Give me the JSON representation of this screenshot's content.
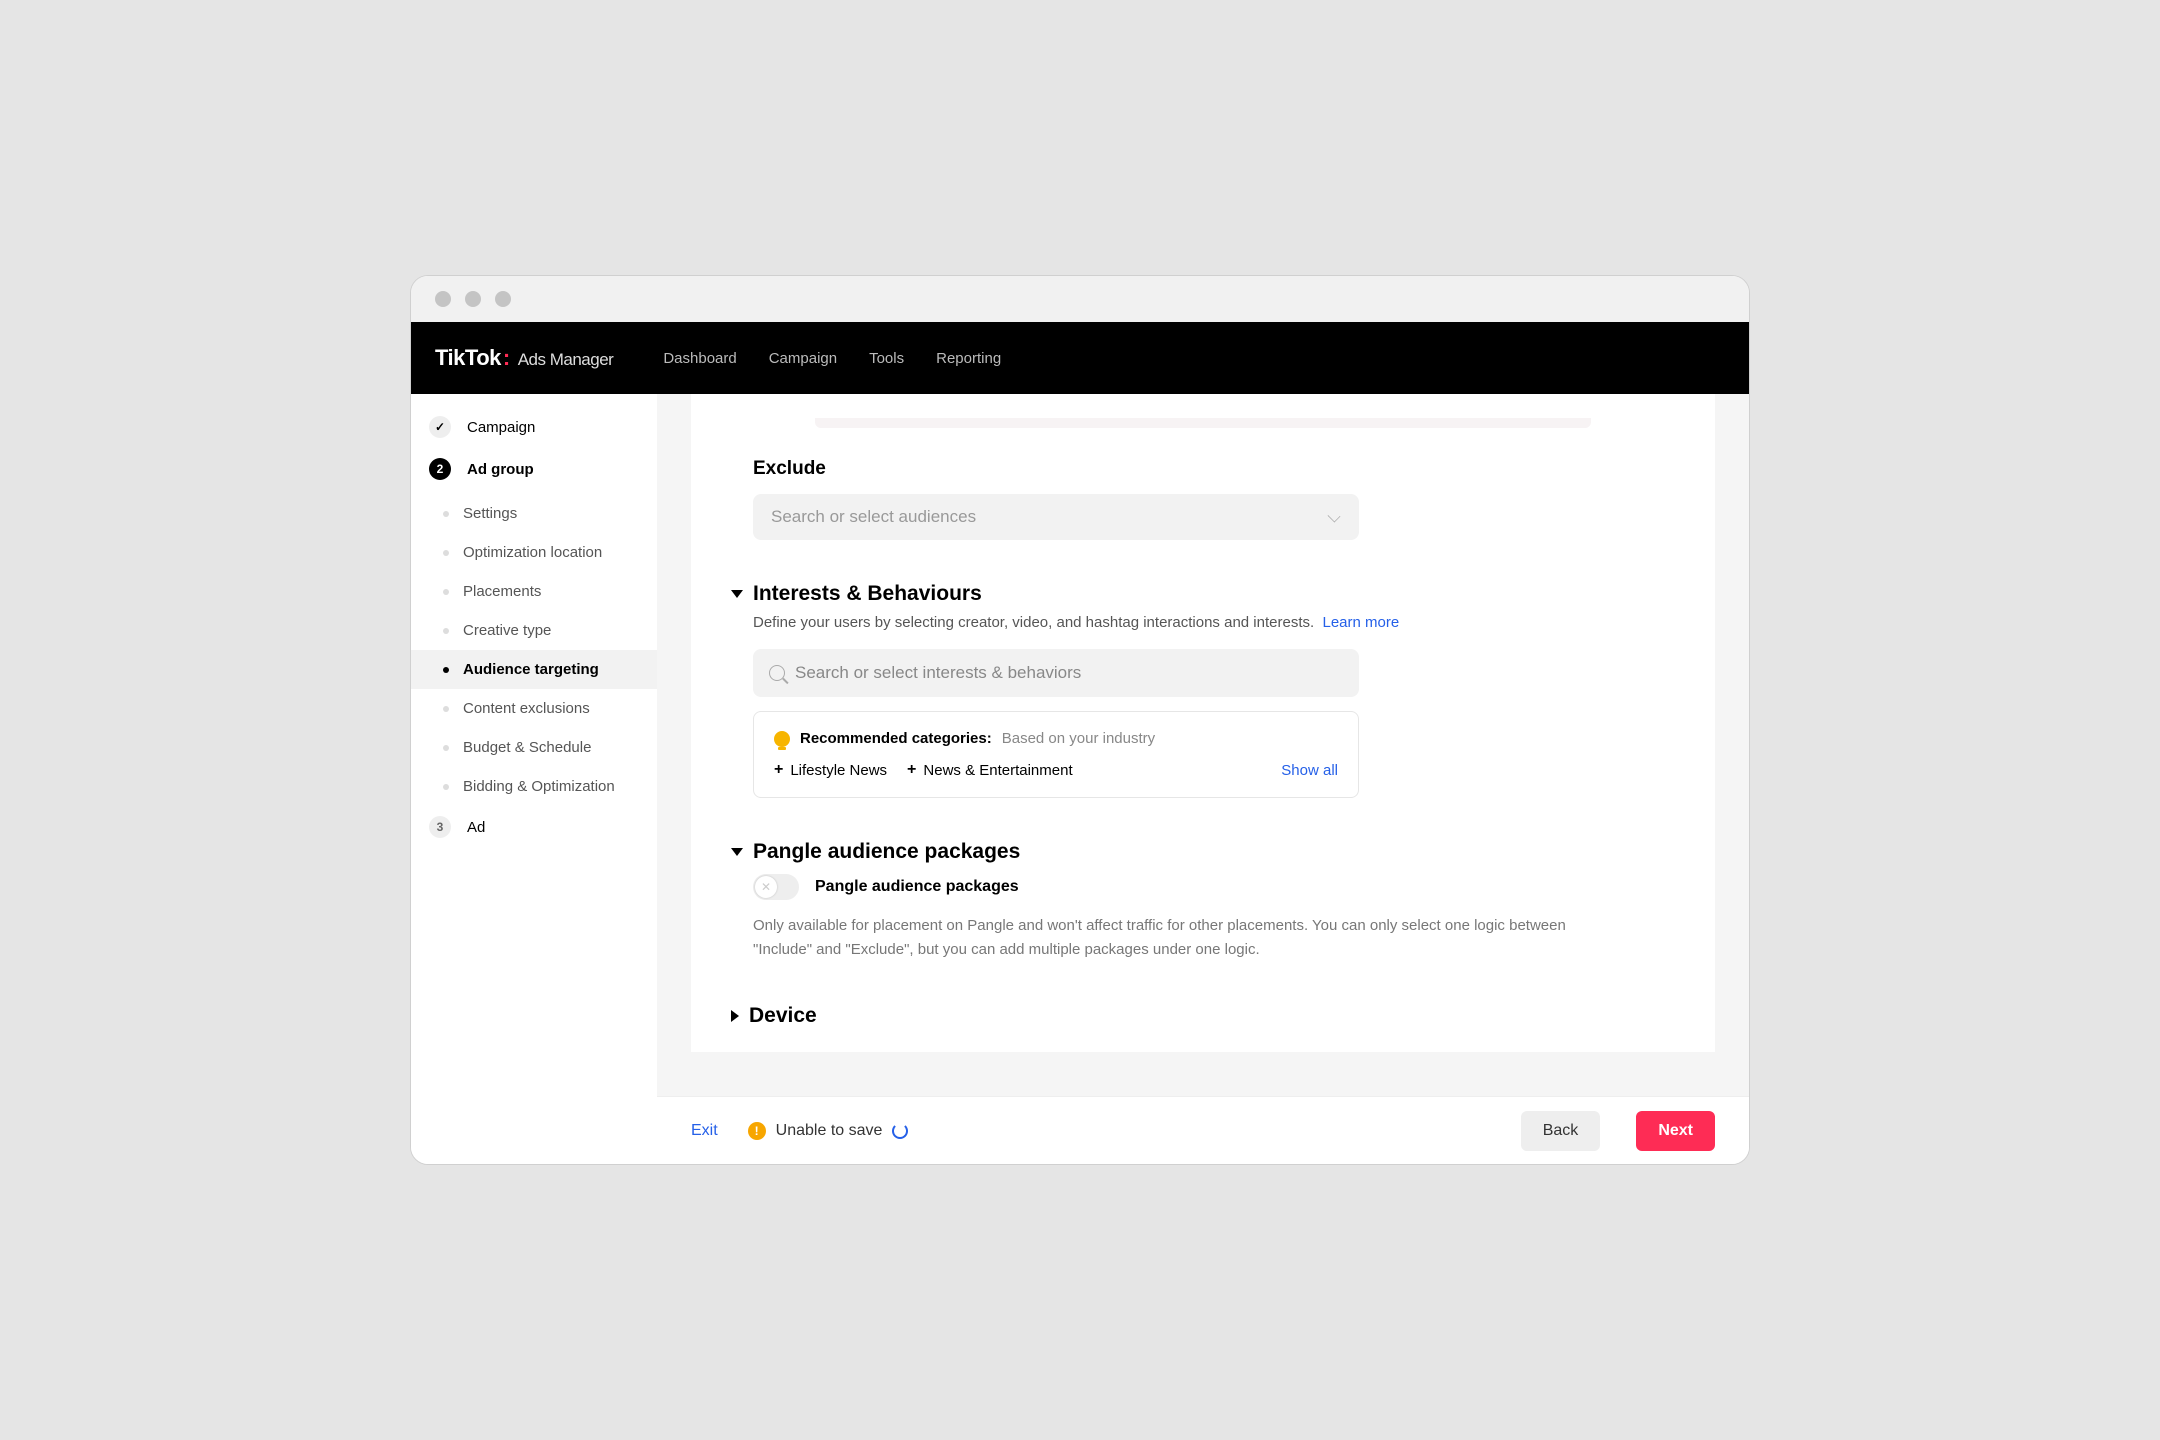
{
  "brand": {
    "name": "TikTok",
    "product": "Ads Manager"
  },
  "topnav": [
    "Dashboard",
    "Campaign",
    "Tools",
    "Reporting"
  ],
  "sidebar": {
    "steps": [
      {
        "label": "Campaign",
        "state": "done"
      },
      {
        "label": "Ad group",
        "state": "current",
        "num": "2"
      },
      {
        "label": "Ad",
        "state": "pending",
        "num": "3"
      }
    ],
    "subitems": [
      "Settings",
      "Optimization location",
      "Placements",
      "Creative type",
      "Audience targeting",
      "Content exclusions",
      "Budget & Schedule",
      "Bidding & Optimization"
    ],
    "active_sub": "Audience targeting"
  },
  "exclude": {
    "title": "Exclude",
    "placeholder": "Search or select audiences"
  },
  "interests": {
    "title": "Interests & Behaviours",
    "desc": "Define your users by selecting creator, video, and hashtag interactions and interests.",
    "learn_more": "Learn more",
    "search_placeholder": "Search or select interests & behaviors",
    "reco_label": "Recommended categories:",
    "reco_sub": "Based on your industry",
    "chips": [
      "Lifestyle News",
      "News & Entertainment"
    ],
    "show_all": "Show all"
  },
  "pangle": {
    "title": "Pangle audience packages",
    "toggle_label": "Pangle audience packages",
    "toggle_on": false,
    "desc": "Only available for placement on Pangle and won't affect traffic for other placements. You can only select one logic between \"Include\" and \"Exclude\", but you can add multiple packages under one logic."
  },
  "device": {
    "title": "Device"
  },
  "footer": {
    "exit": "Exit",
    "warning": "Unable to save",
    "back": "Back",
    "next": "Next"
  }
}
